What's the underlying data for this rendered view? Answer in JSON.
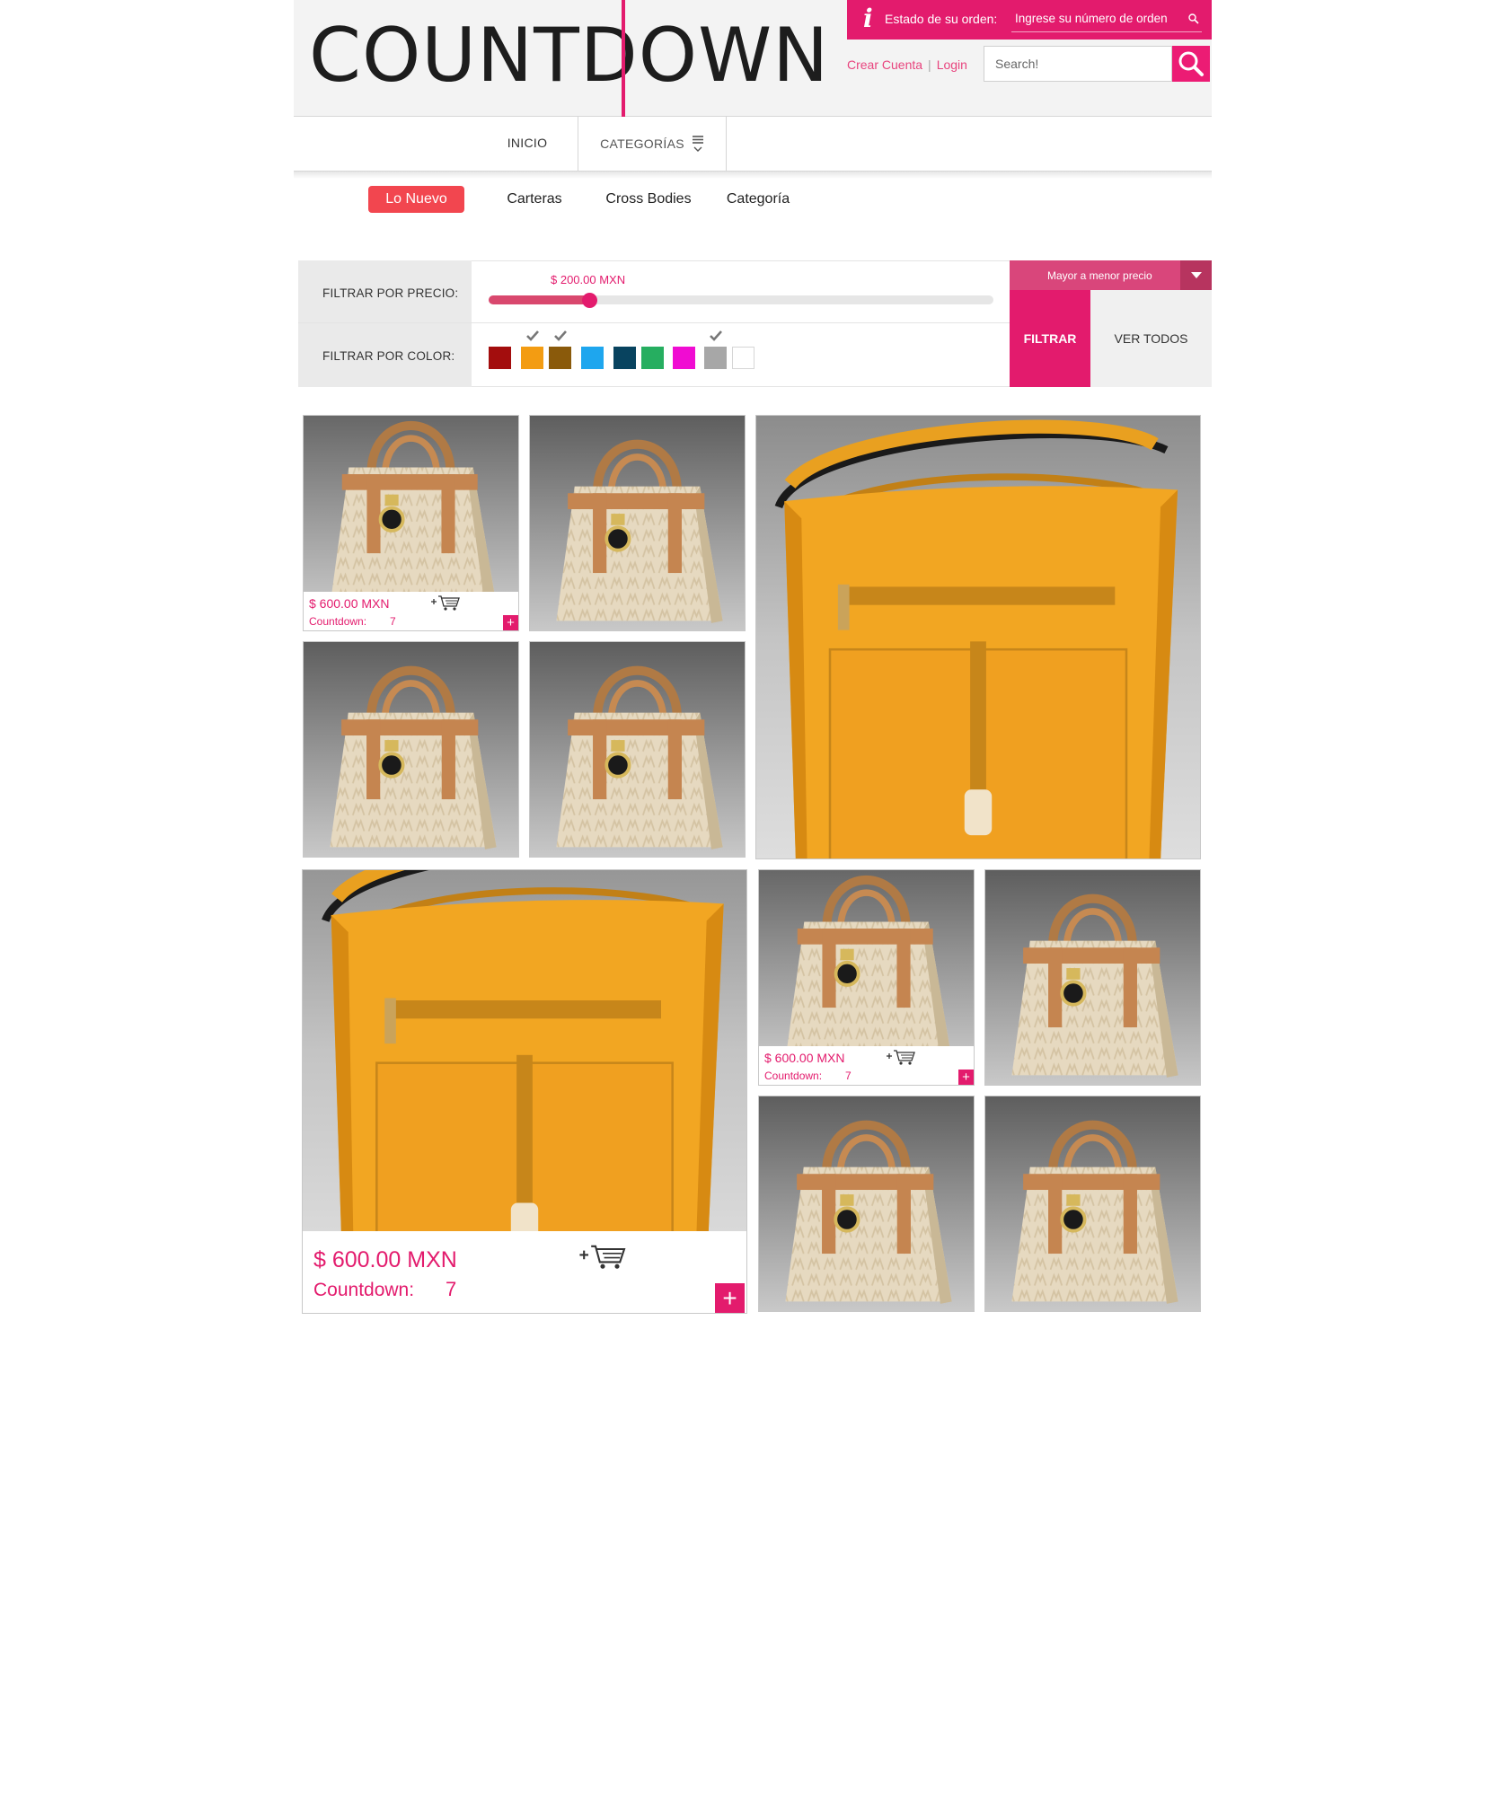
{
  "header": {
    "logo": "COUNTDOWN",
    "order_status_label": "Estado de su orden:",
    "order_input_placeholder": "Ingrese su número de orden",
    "create_account": "Crear Cuenta",
    "separator": "|",
    "login": "Login",
    "search_placeholder": "Search!"
  },
  "nav": {
    "inicio": "INICIO",
    "categorias": "CATEGORÍAS"
  },
  "tabs": [
    "Lo Nuevo",
    "Carteras",
    "Cross Bodies",
    "Categoría"
  ],
  "filters": {
    "price_label": "FILTRAR POR PRECIO:",
    "price_value": "$ 200.00 MXN",
    "slider_fraction": 0.2,
    "color_label": "FILTRAR POR COLOR:",
    "colors": [
      {
        "hex": "#a30d0d",
        "checked": false
      },
      {
        "hex": "#f39c12",
        "checked": true
      },
      {
        "hex": "#8a5a0b",
        "checked": true
      },
      {
        "hex": "#1ea6ee",
        "checked": false
      },
      {
        "hex": "#08435f",
        "checked": false
      },
      {
        "hex": "#26ae60",
        "checked": false
      },
      {
        "hex": "#f00cd2",
        "checked": false
      },
      {
        "hex": "#a7a7a7",
        "checked": true
      },
      {
        "hex": "#ffffff",
        "checked": false
      }
    ],
    "sort_label": "Mayor a menor precio",
    "filter_button": "FILTRAR",
    "view_all_button": "VER TODOS"
  },
  "products": [
    {
      "type": "tote",
      "price": "$ 600.00 MXN",
      "countdown_label": "Countdown:",
      "countdown_value": "7"
    },
    {
      "type": "tote"
    },
    {
      "type": "tote"
    },
    {
      "type": "tote"
    },
    {
      "type": "crossbody"
    },
    {
      "type": "crossbody",
      "price": "$ 600.00 MXN",
      "countdown_label": "Countdown:",
      "countdown_value": "7"
    },
    {
      "type": "tote",
      "price": "$ 600.00 MXN",
      "countdown_label": "Countdown:",
      "countdown_value": "7"
    },
    {
      "type": "tote"
    },
    {
      "type": "tote"
    },
    {
      "type": "tote"
    }
  ],
  "icons": {
    "info": "info-icon",
    "search": "search-icon",
    "menu": "hamburger-icon",
    "chevron": "chevron-down-icon",
    "cart": "add-to-cart-icon",
    "plus": "plus-icon",
    "check": "check-icon"
  },
  "colors": {
    "brand_pink": "#e31b6d",
    "tab_active": "#f2464f",
    "sort_bg": "#d9467b"
  }
}
